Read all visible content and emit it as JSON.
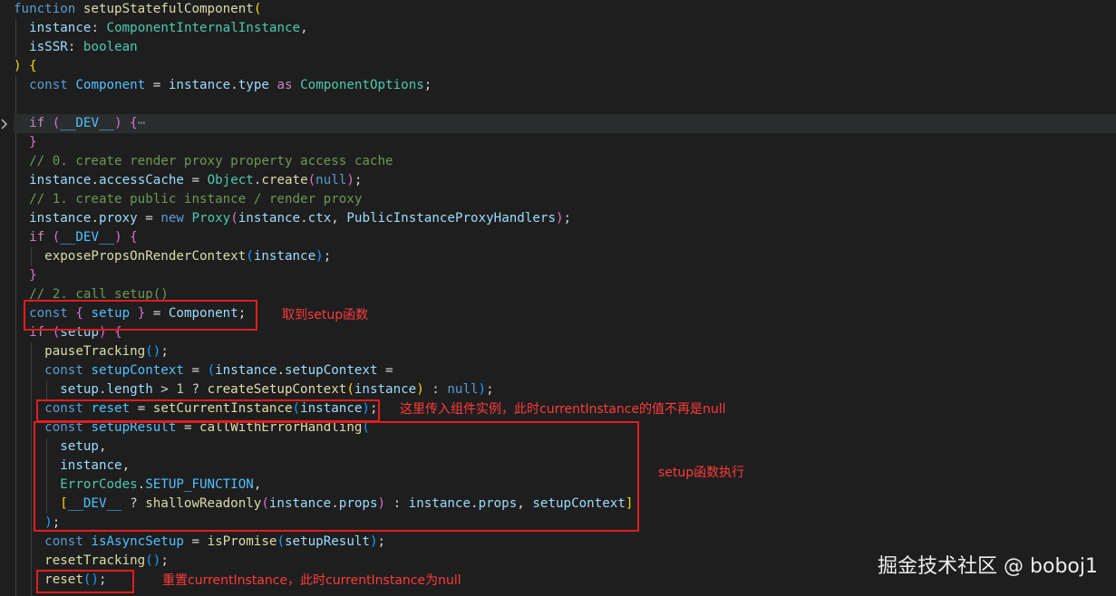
{
  "colors": {
    "background": "#1e1e1e",
    "keyword": "#569cd6",
    "control": "#c586c0",
    "function": "#dcdcaa",
    "type": "#4ec9b0",
    "variable": "#9cdcfe",
    "comment": "#6a9955",
    "annotation": "#ff3a3a"
  },
  "fold_icon": "chevron-right-icon",
  "lines": [
    [
      [
        "kw",
        "function"
      ],
      [
        "op",
        " "
      ],
      [
        "fn",
        "setupStatefulComponent"
      ],
      [
        "p1",
        "("
      ]
    ],
    [
      [
        "op",
        "  "
      ],
      [
        "var",
        "instance"
      ],
      [
        "op",
        ": "
      ],
      [
        "ty",
        "ComponentInternalInstance"
      ],
      [
        "op",
        ","
      ]
    ],
    [
      [
        "op",
        "  "
      ],
      [
        "var",
        "isSSR"
      ],
      [
        "op",
        ": "
      ],
      [
        "ty",
        "boolean"
      ]
    ],
    [
      [
        "p1",
        ")"
      ],
      [
        "op",
        " "
      ],
      [
        "p1",
        "{"
      ]
    ],
    [
      [
        "op",
        "  "
      ],
      [
        "kw",
        "const"
      ],
      [
        "op",
        " "
      ],
      [
        "cnst",
        "Component"
      ],
      [
        "op",
        " = "
      ],
      [
        "var",
        "instance"
      ],
      [
        "op",
        "."
      ],
      [
        "var",
        "type"
      ],
      [
        "op",
        " "
      ],
      [
        "ctl",
        "as"
      ],
      [
        "op",
        " "
      ],
      [
        "ty",
        "ComponentOptions"
      ],
      [
        "op",
        ";"
      ]
    ],
    [],
    [
      [
        "op",
        "  "
      ],
      [
        "ctl",
        "if"
      ],
      [
        "op",
        " "
      ],
      [
        "p2",
        "("
      ],
      [
        "cnst",
        "__DEV__"
      ],
      [
        "p2",
        ")"
      ],
      [
        "op",
        " "
      ],
      [
        "p2",
        "{"
      ],
      [
        "fold-dots",
        "⋯"
      ]
    ],
    [
      [
        "op",
        "  "
      ],
      [
        "p2",
        "}"
      ]
    ],
    [
      [
        "op",
        "  "
      ],
      [
        "cm",
        "// 0. create render proxy property access cache"
      ]
    ],
    [
      [
        "op",
        "  "
      ],
      [
        "var",
        "instance"
      ],
      [
        "op",
        "."
      ],
      [
        "var",
        "accessCache"
      ],
      [
        "op",
        " = "
      ],
      [
        "ty",
        "Object"
      ],
      [
        "op",
        "."
      ],
      [
        "fn",
        "create"
      ],
      [
        "p2",
        "("
      ],
      [
        "kw",
        "null"
      ],
      [
        "p2",
        ")"
      ],
      [
        "op",
        ";"
      ]
    ],
    [
      [
        "op",
        "  "
      ],
      [
        "cm",
        "// 1. create public instance / render proxy"
      ]
    ],
    [
      [
        "op",
        "  "
      ],
      [
        "var",
        "instance"
      ],
      [
        "op",
        "."
      ],
      [
        "var",
        "proxy"
      ],
      [
        "op",
        " = "
      ],
      [
        "kw",
        "new"
      ],
      [
        "op",
        " "
      ],
      [
        "ty",
        "Proxy"
      ],
      [
        "p2",
        "("
      ],
      [
        "var",
        "instance"
      ],
      [
        "op",
        "."
      ],
      [
        "var",
        "ctx"
      ],
      [
        "op",
        ", "
      ],
      [
        "var",
        "PublicInstanceProxyHandlers"
      ],
      [
        "p2",
        ")"
      ],
      [
        "op",
        ";"
      ]
    ],
    [
      [
        "op",
        "  "
      ],
      [
        "ctl",
        "if"
      ],
      [
        "op",
        " "
      ],
      [
        "p2",
        "("
      ],
      [
        "cnst",
        "__DEV__"
      ],
      [
        "p2",
        ")"
      ],
      [
        "op",
        " "
      ],
      [
        "p2",
        "{"
      ]
    ],
    [
      [
        "op",
        "    "
      ],
      [
        "fn",
        "exposePropsOnRenderContext"
      ],
      [
        "p3",
        "("
      ],
      [
        "var",
        "instance"
      ],
      [
        "p3",
        ")"
      ],
      [
        "op",
        ";"
      ]
    ],
    [
      [
        "op",
        "  "
      ],
      [
        "p2",
        "}"
      ]
    ],
    [
      [
        "op",
        "  "
      ],
      [
        "cm",
        "// 2. call setup()"
      ]
    ],
    [
      [
        "op",
        "  "
      ],
      [
        "kw",
        "const"
      ],
      [
        "op",
        " "
      ],
      [
        "p2",
        "{"
      ],
      [
        "op",
        " "
      ],
      [
        "cnst",
        "setup"
      ],
      [
        "op",
        " "
      ],
      [
        "p2",
        "}"
      ],
      [
        "op",
        " = "
      ],
      [
        "var",
        "Component"
      ],
      [
        "op",
        ";"
      ]
    ],
    [
      [
        "op",
        "  "
      ],
      [
        "ctl",
        "if"
      ],
      [
        "op",
        " "
      ],
      [
        "p2",
        "("
      ],
      [
        "var",
        "setup"
      ],
      [
        "p2",
        ")"
      ],
      [
        "op",
        " "
      ],
      [
        "p2",
        "{"
      ]
    ],
    [
      [
        "op",
        "    "
      ],
      [
        "fn",
        "pauseTracking"
      ],
      [
        "p3",
        "()"
      ],
      [
        "op",
        ";"
      ]
    ],
    [
      [
        "op",
        "    "
      ],
      [
        "kw",
        "const"
      ],
      [
        "op",
        " "
      ],
      [
        "cnst",
        "setupContext"
      ],
      [
        "op",
        " = "
      ],
      [
        "p3",
        "("
      ],
      [
        "var",
        "instance"
      ],
      [
        "op",
        "."
      ],
      [
        "var",
        "setupContext"
      ],
      [
        "op",
        " ="
      ]
    ],
    [
      [
        "op",
        "      "
      ],
      [
        "var",
        "setup"
      ],
      [
        "op",
        "."
      ],
      [
        "var",
        "length"
      ],
      [
        "op",
        " > "
      ],
      [
        "num",
        "1"
      ],
      [
        "op",
        " ? "
      ],
      [
        "fn",
        "createSetupContext"
      ],
      [
        "p1",
        "("
      ],
      [
        "var",
        "instance"
      ],
      [
        "p1",
        ")"
      ],
      [
        "op",
        " : "
      ],
      [
        "kw",
        "null"
      ],
      [
        "p3",
        ")"
      ],
      [
        "op",
        ";"
      ]
    ],
    [
      [
        "op",
        "    "
      ],
      [
        "kw",
        "const"
      ],
      [
        "op",
        " "
      ],
      [
        "cnst",
        "reset"
      ],
      [
        "op",
        " = "
      ],
      [
        "fn",
        "setCurrentInstance"
      ],
      [
        "p3",
        "("
      ],
      [
        "var",
        "instance"
      ],
      [
        "p3",
        ")"
      ],
      [
        "op",
        ";"
      ]
    ],
    [
      [
        "op",
        "    "
      ],
      [
        "kw",
        "const"
      ],
      [
        "op",
        " "
      ],
      [
        "cnst",
        "setupResult"
      ],
      [
        "op",
        " = "
      ],
      [
        "fn",
        "callWithErrorHandling"
      ],
      [
        "p3",
        "("
      ]
    ],
    [
      [
        "op",
        "      "
      ],
      [
        "var",
        "setup"
      ],
      [
        "op",
        ","
      ]
    ],
    [
      [
        "op",
        "      "
      ],
      [
        "var",
        "instance"
      ],
      [
        "op",
        ","
      ]
    ],
    [
      [
        "op",
        "      "
      ],
      [
        "ty",
        "ErrorCodes"
      ],
      [
        "op",
        "."
      ],
      [
        "cnst",
        "SETUP_FUNCTION"
      ],
      [
        "op",
        ","
      ]
    ],
    [
      [
        "op",
        "      "
      ],
      [
        "p1",
        "["
      ],
      [
        "cnst",
        "__DEV__"
      ],
      [
        "op",
        " ? "
      ],
      [
        "fn",
        "shallowReadonly"
      ],
      [
        "p2",
        "("
      ],
      [
        "var",
        "instance"
      ],
      [
        "op",
        "."
      ],
      [
        "var",
        "props"
      ],
      [
        "p2",
        ")"
      ],
      [
        "op",
        " : "
      ],
      [
        "var",
        "instance"
      ],
      [
        "op",
        "."
      ],
      [
        "var",
        "props"
      ],
      [
        "op",
        ", "
      ],
      [
        "var",
        "setupContext"
      ],
      [
        "p1",
        "]"
      ]
    ],
    [
      [
        "op",
        "    "
      ],
      [
        "p3",
        ")"
      ],
      [
        "op",
        ";"
      ]
    ],
    [
      [
        "op",
        "    "
      ],
      [
        "kw",
        "const"
      ],
      [
        "op",
        " "
      ],
      [
        "cnst",
        "isAsyncSetup"
      ],
      [
        "op",
        " = "
      ],
      [
        "fn",
        "isPromise"
      ],
      [
        "p3",
        "("
      ],
      [
        "var",
        "setupResult"
      ],
      [
        "p3",
        ")"
      ],
      [
        "op",
        ";"
      ]
    ],
    [
      [
        "op",
        "    "
      ],
      [
        "fn",
        "resetTracking"
      ],
      [
        "p3",
        "()"
      ],
      [
        "op",
        ";"
      ]
    ],
    [
      [
        "op",
        "    "
      ],
      [
        "fn",
        "reset"
      ],
      [
        "p3",
        "()"
      ],
      [
        "op",
        ";"
      ]
    ]
  ],
  "annotations": {
    "get_setup": "取到setup函数",
    "pass_instance": "这里传入组件实例，此时currentInstance的值不再是null",
    "setup_exec": "setup函数执行",
    "reset_note": "重置currentInstance，此时currentInstance为null"
  },
  "watermark": "掘金技术社区 @ boboj1"
}
